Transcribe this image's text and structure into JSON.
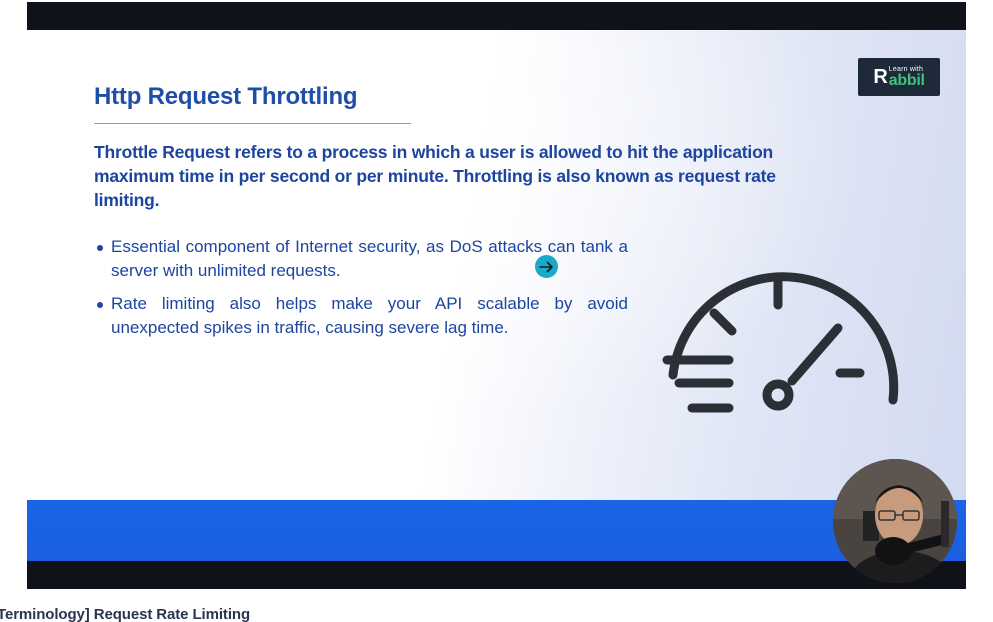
{
  "slide": {
    "title": "Http Request Throttling",
    "lead": "Throttle Request refers to a process in which a user is allowed to hit the application maximum time in per second or per minute.  Throttling is also known as request rate limiting.",
    "bullets": [
      "Essential component of Internet security, as DoS attacks can tank a server with unlimited requests.",
      "Rate limiting also helps make your API scalable by avoid unexpected spikes in traffic, causing severe lag time."
    ],
    "illustration_icon": "speedometer-throttle-icon"
  },
  "logo": {
    "tagline": "Learn with",
    "brand": "abbil",
    "initial": "R",
    "colors": {
      "background": "#1e2a3a",
      "brand_text": "#43c07e"
    }
  },
  "cursor_icon": "arrow-right-circle-icon",
  "webcam": {
    "icon": "presenter-webcam-icon"
  },
  "caption": {
    "text": "Terminology] Request Rate Limiting"
  },
  "colors": {
    "title": "#1f4ea8",
    "body_text": "#1d45a0",
    "band": "#1b64e6",
    "player_bg": "#0f1218"
  }
}
